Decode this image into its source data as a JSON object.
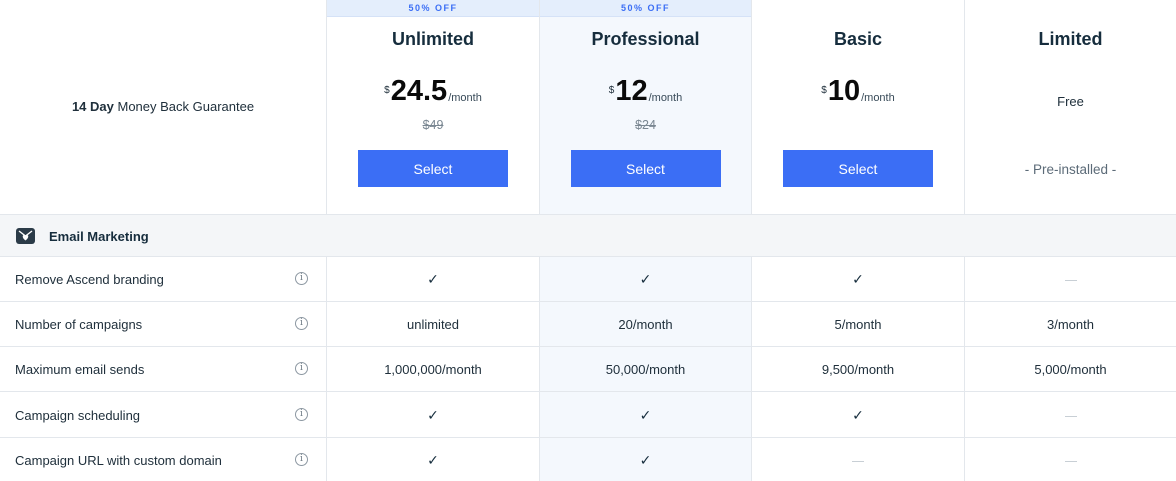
{
  "guarantee": {
    "bold": "14 Day",
    "rest": "Money Back Guarantee"
  },
  "plans": [
    {
      "badge": "50% OFF",
      "name": "Unlimited",
      "currency": "$",
      "amount": "24.5",
      "per": "/month",
      "old_price": "$49",
      "button": "Select"
    },
    {
      "badge": "50% OFF",
      "name": "Professional",
      "currency": "$",
      "amount": "12",
      "per": "/month",
      "old_price": "$24",
      "button": "Select"
    },
    {
      "badge": "",
      "name": "Basic",
      "currency": "$",
      "amount": "10",
      "per": "/month",
      "old_price": "",
      "button": "Select"
    },
    {
      "badge": "",
      "name": "Limited",
      "price_text": "Free",
      "note": "- Pre-installed -"
    }
  ],
  "section": {
    "title": "Email Marketing",
    "icon": "mail-heart-icon"
  },
  "features": [
    {
      "label": "Remove Ascend branding",
      "values": [
        "check",
        "check",
        "check",
        "dash"
      ]
    },
    {
      "label": "Number of campaigns",
      "values": [
        "unlimited",
        "20/month",
        "5/month",
        "3/month"
      ]
    },
    {
      "label": "Maximum email sends",
      "values": [
        "1,000,000/month",
        "50,000/month",
        "9,500/month",
        "5,000/month"
      ]
    },
    {
      "label": "Campaign scheduling",
      "values": [
        "check",
        "check",
        "check",
        "dash"
      ]
    },
    {
      "label": "Campaign URL with custom domain",
      "values": [
        "check",
        "check",
        "dash",
        "dash"
      ]
    }
  ],
  "info_glyph": "i",
  "colors": {
    "accent": "#3b6ef5",
    "highlight_bg": "#f4f8fd",
    "badge_bg": "#e4eefc"
  }
}
